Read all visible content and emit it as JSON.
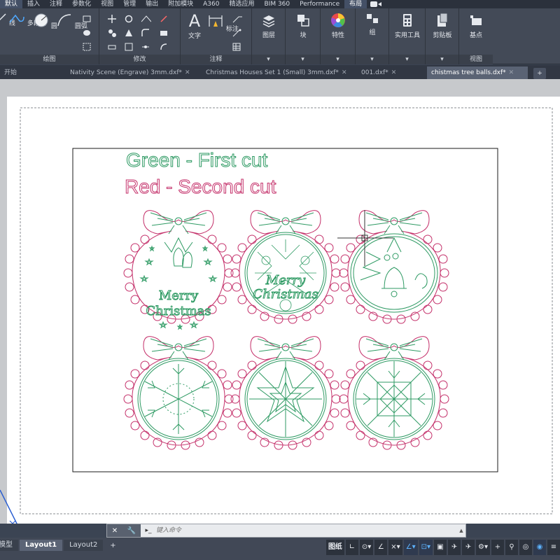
{
  "menu_tabs": [
    "默认",
    "插入",
    "注释",
    "参数化",
    "视图",
    "管理",
    "输出",
    "附加模块",
    "A360",
    "精选应用",
    "BIM 360",
    "Performance",
    "布局"
  ],
  "ribbon": {
    "draw_panel": {
      "title": "绘图",
      "buttons": [
        "线",
        "多段线",
        "圆",
        "圆弧"
      ]
    },
    "modify_panel": {
      "title": "修改"
    },
    "annotation_panel": {
      "title": "注释",
      "buttons": [
        "文字",
        "标注"
      ]
    },
    "layers_panel": {
      "label": "图层"
    },
    "block_panel": {
      "label": "块"
    },
    "properties_panel": {
      "label": "特性"
    },
    "group_panel": {
      "label": "组"
    },
    "utilities_panel": {
      "label": "实用工具"
    },
    "clipboard_panel": {
      "label": "剪贴板"
    },
    "view_panel": {
      "title": "视图",
      "buttons": [
        "基点"
      ]
    }
  },
  "doc_tabs": [
    {
      "label": "开始",
      "active": false
    },
    {
      "label": "Nativity Scene (Engrave) 3mm.dxf*",
      "active": false
    },
    {
      "label": "Christmas Houses Set 1 (Small) 3mm.dxf*",
      "active": false
    },
    {
      "label": "001.dxf*",
      "active": false
    },
    {
      "label": "chistmas tree balls.dxf*",
      "active": true
    }
  ],
  "drawing": {
    "legend_green": "Green - First cut",
    "legend_red": "Red - Second cut",
    "ornament_1_text_1": "Merry",
    "ornament_1_text_2": "Christmas",
    "ornament_2_text_1": "Merry",
    "ornament_2_text_2": "Christmas",
    "colors": {
      "first_cut": "#2e9a63",
      "second_cut": "#c4306a"
    }
  },
  "command_line": {
    "placeholder": "键入命令",
    "prompt": "▸_"
  },
  "layout_tabs": [
    {
      "label": "模型",
      "active": false
    },
    {
      "label": "Layout1",
      "active": true
    },
    {
      "label": "Layout2",
      "active": false
    }
  ],
  "status_bar": {
    "paper_mode": "图纸"
  }
}
